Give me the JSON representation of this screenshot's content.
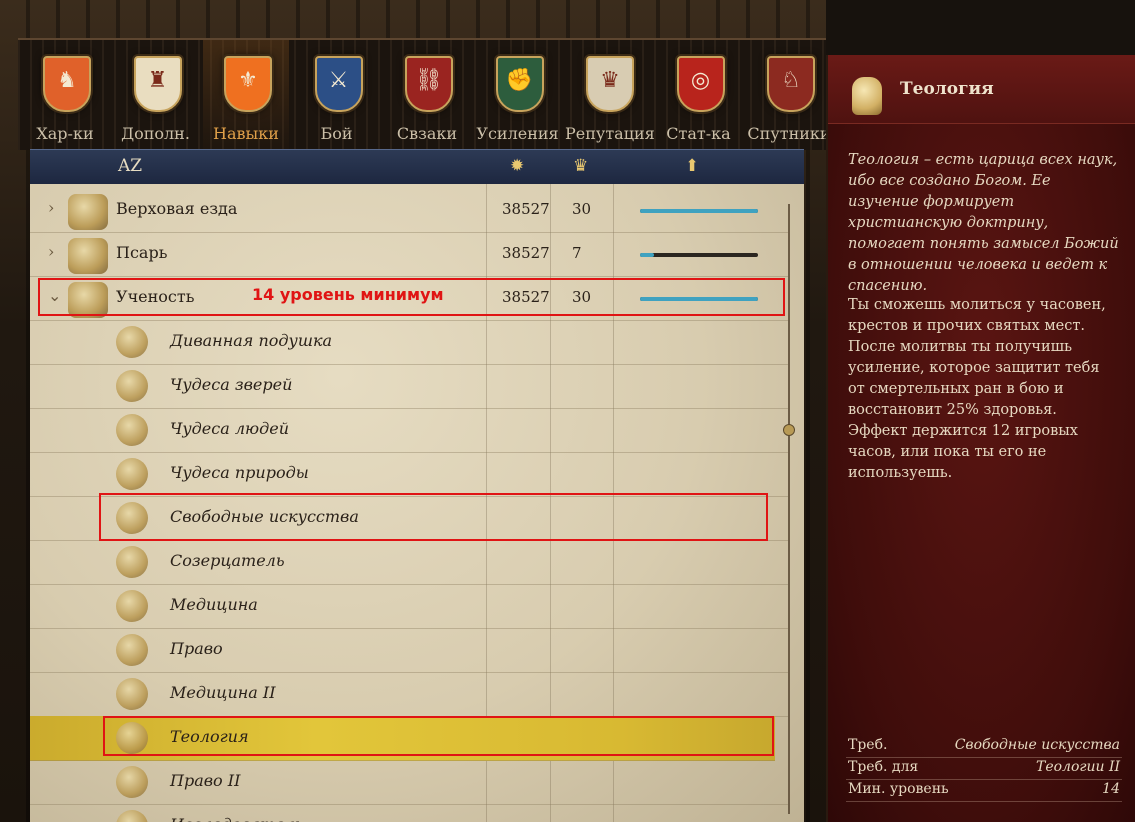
{
  "tabs": [
    {
      "label": "Хар-ки",
      "icon": "rider-crest-icon",
      "color": "#e0612a",
      "glyph": "♞",
      "active": false
    },
    {
      "label": "Дополн.",
      "icon": "warrior-crest-icon",
      "color": "#e9ddc0",
      "glyph": "♜",
      "active": false
    },
    {
      "label": "Навыки",
      "icon": "lily-crest-icon",
      "color": "#ef7020",
      "glyph": "⚜",
      "active": true
    },
    {
      "label": "Бой",
      "icon": "sword-crest-icon",
      "color": "#2c4f86",
      "glyph": "⚔",
      "active": false
    },
    {
      "label": "Свзаки",
      "icon": "chain-crest-icon",
      "color": "#9a2420",
      "glyph": "⛓",
      "active": false
    },
    {
      "label": "Усиления",
      "icon": "fist-crest-icon",
      "color": "#2d5d3d",
      "glyph": "✊",
      "active": false
    },
    {
      "label": "Репутация",
      "icon": "crown-crest-icon",
      "color": "#d8ccb2",
      "glyph": "♛",
      "active": false
    },
    {
      "label": "Стат-ка",
      "icon": "target-crest-icon",
      "color": "#b8241c",
      "glyph": "◎",
      "active": false
    },
    {
      "label": "Спутники",
      "icon": "dog-crest-icon",
      "color": "#8c2a20",
      "glyph": "♘",
      "active": false
    }
  ],
  "list_header": {
    "sort_label": "AZ",
    "xp_icon": "sun-icon",
    "level_icon": "crown-icon",
    "progress_icon": "arrow-up-icon"
  },
  "skills": [
    {
      "name": "Верховая езда",
      "xp": "38527",
      "level": "30",
      "progress": 1.0,
      "expanded": false
    },
    {
      "name": "Псарь",
      "xp": "38527",
      "level": "7",
      "progress": 0.12,
      "expanded": false
    },
    {
      "name": "Ученость",
      "xp": "38527",
      "level": "30",
      "progress": 1.0,
      "expanded": true
    }
  ],
  "perks": [
    {
      "name": "Диванная подушка"
    },
    {
      "name": "Чудеса зверей"
    },
    {
      "name": "Чудеса людей"
    },
    {
      "name": "Чудеса природы"
    },
    {
      "name": "Свободные искусства"
    },
    {
      "name": "Созерцатель"
    },
    {
      "name": "Медицина"
    },
    {
      "name": "Право"
    },
    {
      "name": "Медицина II"
    },
    {
      "name": "Теология",
      "selected": true
    },
    {
      "name": "Право II"
    },
    {
      "name": "Исследователь"
    }
  ],
  "annotation": "14 уровень минимум",
  "info": {
    "title": "Теология",
    "description_italic": "Теология – есть царица всех наук, ибо все создано Богом. Ее изучение формирует христианскую доктрину, помогает понять замысел Божий в отношении человека и ведет к спасению.",
    "description": "Ты сможешь молиться у часовен, крестов и прочих святых мест. После молитвы ты получишь усиление, которое защитит тебя от смертельных ран в бою и восстановит 25% здоровья. Эффект держится 12 игровых часов, или пока ты его не используешь.",
    "requirements": [
      {
        "key": "Треб.",
        "value": "Свободные искусства"
      },
      {
        "key": "Треб. для",
        "value": "Теологии II"
      },
      {
        "key": "Мин. уровень",
        "value": "14"
      }
    ]
  },
  "colors": {
    "accent_gold": "#e0a049",
    "selection": "#e2c63a",
    "progress": "#3fa2c0",
    "highlight_box": "#e01414",
    "info_bg": "#4a0f0d"
  }
}
